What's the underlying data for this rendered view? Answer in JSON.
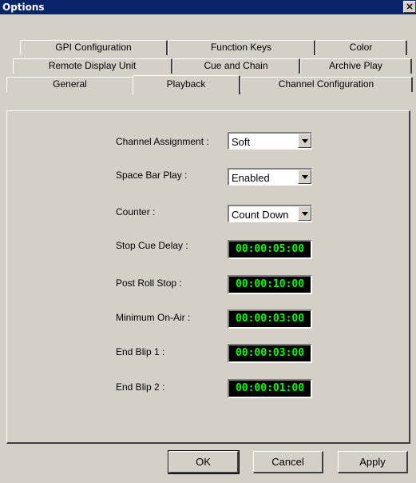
{
  "window": {
    "title": "Options",
    "close_label": "×"
  },
  "tabs": {
    "row1": [
      {
        "label": "GPI Configuration"
      },
      {
        "label": "Function Keys"
      },
      {
        "label": "Color"
      }
    ],
    "row2": [
      {
        "label": "Remote Display Unit"
      },
      {
        "label": "Cue and Chain"
      },
      {
        "label": "Archive Play"
      }
    ],
    "row3": [
      {
        "label": "General"
      },
      {
        "label": "Playback"
      },
      {
        "label": "Channel Configuration"
      }
    ],
    "active": "Playback"
  },
  "playback": {
    "channel_assignment": {
      "label": "Channel Assignment :",
      "value": "Soft"
    },
    "space_bar_play": {
      "label": "Space Bar Play :",
      "value": "Enabled"
    },
    "counter": {
      "label": "Counter :",
      "value": "Count Down"
    },
    "stop_cue_delay": {
      "label": "Stop Cue Delay :",
      "value": "00:00:05:00"
    },
    "post_roll_stop": {
      "label": "Post Roll Stop :",
      "value": "00:00:10:00"
    },
    "minimum_on_air": {
      "label": "Minimum On-Air :",
      "value": "00:00:03:00"
    },
    "end_blip_1": {
      "label": "End Blip 1 :",
      "value": "00:00:03:00"
    },
    "end_blip_2": {
      "label": "End Blip 2 :",
      "value": "00:00:01:00"
    }
  },
  "buttons": {
    "ok": "OK",
    "cancel": "Cancel",
    "apply": "Apply"
  },
  "colors": {
    "titlebar": "#0a246a",
    "face": "#d4d0c8",
    "timecode_text": "#00ff00",
    "timecode_bg": "#000000"
  }
}
